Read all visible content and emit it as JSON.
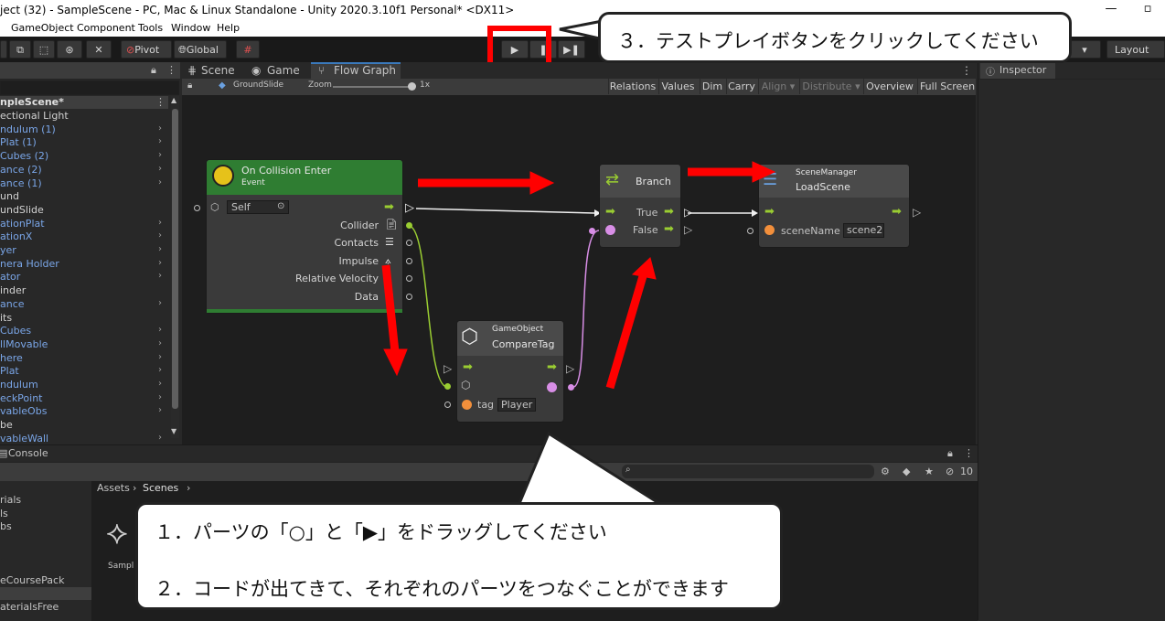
{
  "window": {
    "title": "ject (32) - SampleScene - PC, Mac & Linux Standalone - Unity 2020.3.10f1 Personal* <DX11>",
    "controls": {
      "minimize": "—",
      "maximize": "▫"
    }
  },
  "menu": [
    "GameObject",
    "Component",
    "Tools",
    "Window",
    "Help"
  ],
  "toolbar": {
    "pivot": "Pivot",
    "global": "Global",
    "layout": "Layout"
  },
  "hierarchy": {
    "scene": "npleScene*",
    "items": [
      {
        "label": "ectional Light",
        "color": "white",
        "arrow": false
      },
      {
        "label": "ndulum (1)",
        "color": "blue",
        "arrow": true
      },
      {
        "label": "Plat (1)",
        "color": "blue",
        "arrow": true
      },
      {
        "label": "Cubes (2)",
        "color": "blue",
        "arrow": true
      },
      {
        "label": "ance (2)",
        "color": "blue",
        "arrow": true
      },
      {
        "label": "ance (1)",
        "color": "blue",
        "arrow": true
      },
      {
        "label": "und",
        "color": "white",
        "arrow": false
      },
      {
        "label": "undSlide",
        "color": "white",
        "arrow": false
      },
      {
        "label": "ationPlat",
        "color": "blue",
        "arrow": true
      },
      {
        "label": "ationX",
        "color": "blue",
        "arrow": true
      },
      {
        "label": "yer",
        "color": "blue",
        "arrow": true
      },
      {
        "label": "nera Holder",
        "color": "blue",
        "arrow": true
      },
      {
        "label": "ator",
        "color": "blue",
        "arrow": true
      },
      {
        "label": "inder",
        "color": "white",
        "arrow": false
      },
      {
        "label": "ance",
        "color": "blue",
        "arrow": true
      },
      {
        "label": "its",
        "color": "white",
        "arrow": false
      },
      {
        "label": "Cubes",
        "color": "blue",
        "arrow": true
      },
      {
        "label": "llMovable",
        "color": "blue",
        "arrow": true
      },
      {
        "label": "here",
        "color": "blue",
        "arrow": true
      },
      {
        "label": "Plat",
        "color": "blue",
        "arrow": true
      },
      {
        "label": "ndulum",
        "color": "blue",
        "arrow": true
      },
      {
        "label": "eckPoint",
        "color": "blue",
        "arrow": true
      },
      {
        "label": "vableObs",
        "color": "blue",
        "arrow": true
      },
      {
        "label": "be",
        "color": "white",
        "arrow": false
      },
      {
        "label": "vableWall",
        "color": "blue",
        "arrow": true
      }
    ]
  },
  "tabs": {
    "scene": "Scene",
    "game": "Game",
    "flow_graph": "Flow Graph",
    "inspector": "Inspector",
    "console": "Console"
  },
  "graph_toolbar": {
    "graph_name": "GroundSlide",
    "zoom_label": "Zoom",
    "zoom_value": "1x",
    "buttons": [
      "Relations",
      "Values",
      "Dim",
      "Carry",
      "Align ▾",
      "Distribute ▾",
      "Overview",
      "Full Screen"
    ]
  },
  "nodes": {
    "collision": {
      "title": "On Collision Enter",
      "subtitle": "Event",
      "target": "Self",
      "outputs": [
        "Collider",
        "Contacts",
        "Impulse",
        "Relative Velocity",
        "Data"
      ]
    },
    "comparetag": {
      "subtitle": "GameObject",
      "title": "CompareTag",
      "tag_label": "tag",
      "tag_value": "Player"
    },
    "branch": {
      "title": "Branch",
      "true_label": "True",
      "false_label": "False"
    },
    "loadscene": {
      "subtitle": "SceneManager",
      "title": "LoadScene",
      "param_label": "sceneName",
      "param_value": "scene2"
    }
  },
  "project": {
    "breadcrumb": [
      "Assets",
      "Scenes"
    ],
    "left_items": [
      "rials",
      "ls",
      "bs",
      "eCoursePack",
      "aterialsFree"
    ],
    "asset_name": "Sampl",
    "counter": "10"
  },
  "callouts": {
    "top": "３．テストプレイボタンをクリックしてください",
    "bottom_line1": "１．パーツの「○」と「▶」をドラッグしてください",
    "bottom_line2": "２．コードが出てきて、それぞれのパーツをつなぐことができます"
  },
  "colors": {
    "accent_red": "#ff0000",
    "event_green": "#2f7d32",
    "link_blue": "#7aa6e8",
    "flow_arrow": "#9acd32",
    "port_orange": "#f28f3b",
    "port_purple": "#d88ee6"
  }
}
